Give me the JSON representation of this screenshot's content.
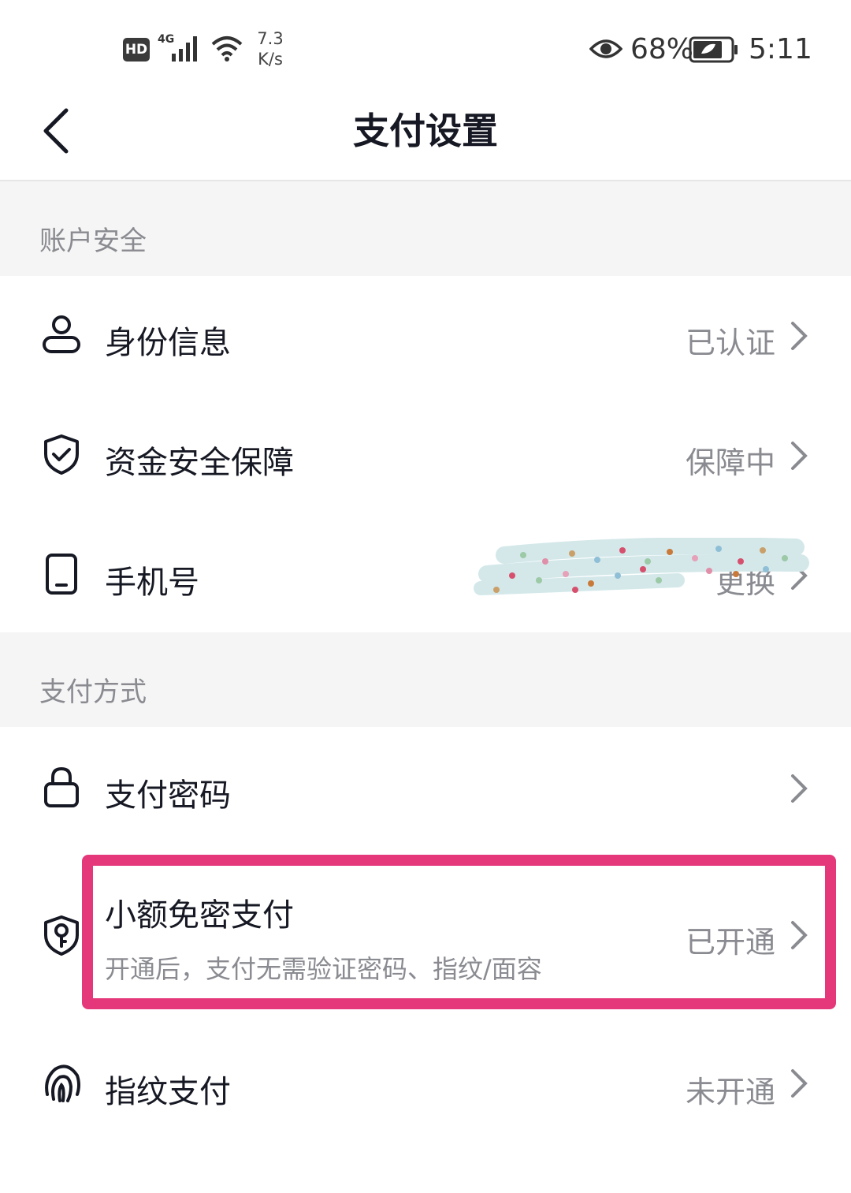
{
  "status_bar": {
    "hd": "HD",
    "network": "4G",
    "speed_value": "7.3",
    "speed_unit": "K/s",
    "battery_percent": "68%",
    "time": "5:11"
  },
  "nav": {
    "title": "支付设置"
  },
  "sections": {
    "account_security": "账户安全",
    "payment_methods": "支付方式"
  },
  "rows": {
    "identity": {
      "label": "身份信息",
      "value": "已认证",
      "icon": "person-icon"
    },
    "fund_security": {
      "label": "资金安全保障",
      "value": "保障中",
      "icon": "shield-check-icon"
    },
    "phone": {
      "label": "手机号",
      "value": "更换",
      "icon": "phone-icon"
    },
    "pay_password": {
      "label": "支付密码",
      "value": "",
      "icon": "lock-icon"
    },
    "small_free": {
      "label": "小额免密支付",
      "sublabel": "开通后，支付无需验证密码、指纹/面容",
      "value": "已开通",
      "icon": "shield-key-icon"
    },
    "fingerprint": {
      "label": "指纹支付",
      "value": "未开通",
      "icon": "fingerprint-icon"
    }
  },
  "colors": {
    "highlight": "#e4387a",
    "section_bg": "#f5f5f5",
    "secondary_text": "#8a8b91"
  }
}
